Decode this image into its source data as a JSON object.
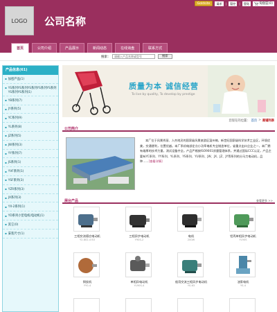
{
  "header": {
    "logo_text": "LOGO",
    "company_name": "公司名称",
    "top_button": "Goldsite",
    "top_links": [
      "请求",
      "管控",
      "登陆"
    ],
    "cart_label": "询盘篮(0)",
    "brand_color": "#9a2f5e"
  },
  "nav": {
    "tabs": [
      "首页",
      "公司介绍",
      "产品展示",
      "新闻动态",
      "在线询盘",
      "联系方式"
    ],
    "active": "首页"
  },
  "search": {
    "label": "搜索：",
    "placeholder": "请输入产品名称或型号",
    "button": "搜索"
  },
  "sidebar": {
    "title": "产品信息(61)",
    "items": [
      "加密产品(1)",
      "YS系列YS系列YS系列YS系列YS系列YS系列YS系列(1)",
      "YB系列(7)",
      "JY系列(5)",
      "YC系列(9)",
      "YL系列(8)",
      "JZ系列(5)",
      "JW系列(3)",
      "YY系列(7)",
      "JS系列(1)",
      "YVF系列(1)",
      "YSF系列(3)",
      "YZR系列(3)",
      "JX系列(3)",
      "YX-2系列(1)",
      "YD系列小型电机/电动机(1)",
      "其它(0)",
      "安装尺寸(1)"
    ]
  },
  "banner": {
    "title": "质量为本  诚信经营",
    "subtitle": "To live by quality, To develop by prestige"
  },
  "breadcrumb": {
    "prefix": "您现在的位置：",
    "home": "首页",
    "sep": ">",
    "current": "商铺列表"
  },
  "intro": {
    "title": "公司简介",
    "text": "本厂位于风景秀丽、人杰地灵的国家级风景旅游区温州楠，新世纪国家级科学技术工业区，环境优美，交通便利，位置优越。本厂系机电部定点小功率电机专业制造单位，省重点出口企业之一，本厂拥有雄厚的技术力量，测试设备齐全。产品严格按ISO9001质量管理体系，并通过国际CCC认证，产品主要有YC系列、YY系列、YL系列、YS系列、YU系列、JW、JX、JZ、JY等系列的分马力电动机，品种……",
    "more": "[查看详情]"
  },
  "products": {
    "title": "展台产品",
    "more": "查看更多 >>",
    "items": [
      {
        "name": "三相交流感应电动机",
        "model": "Y2-802-4 B3"
      },
      {
        "name": "三相异步电动机",
        "model": "Y90S-2"
      },
      {
        "name": "电机",
        "model": "200W"
      },
      {
        "name": "铝壳单相异步电动机",
        "model": "YL90S"
      },
      {
        "name": "铜绕机",
        "model": "YY0-4"
      },
      {
        "name": "单相异电动机",
        "model": "YL90S-4"
      },
      {
        "name": "船用交流三相异步电动机",
        "model": "YS-63"
      },
      {
        "name": "油泵电机",
        "model": "YS-4"
      }
    ]
  }
}
